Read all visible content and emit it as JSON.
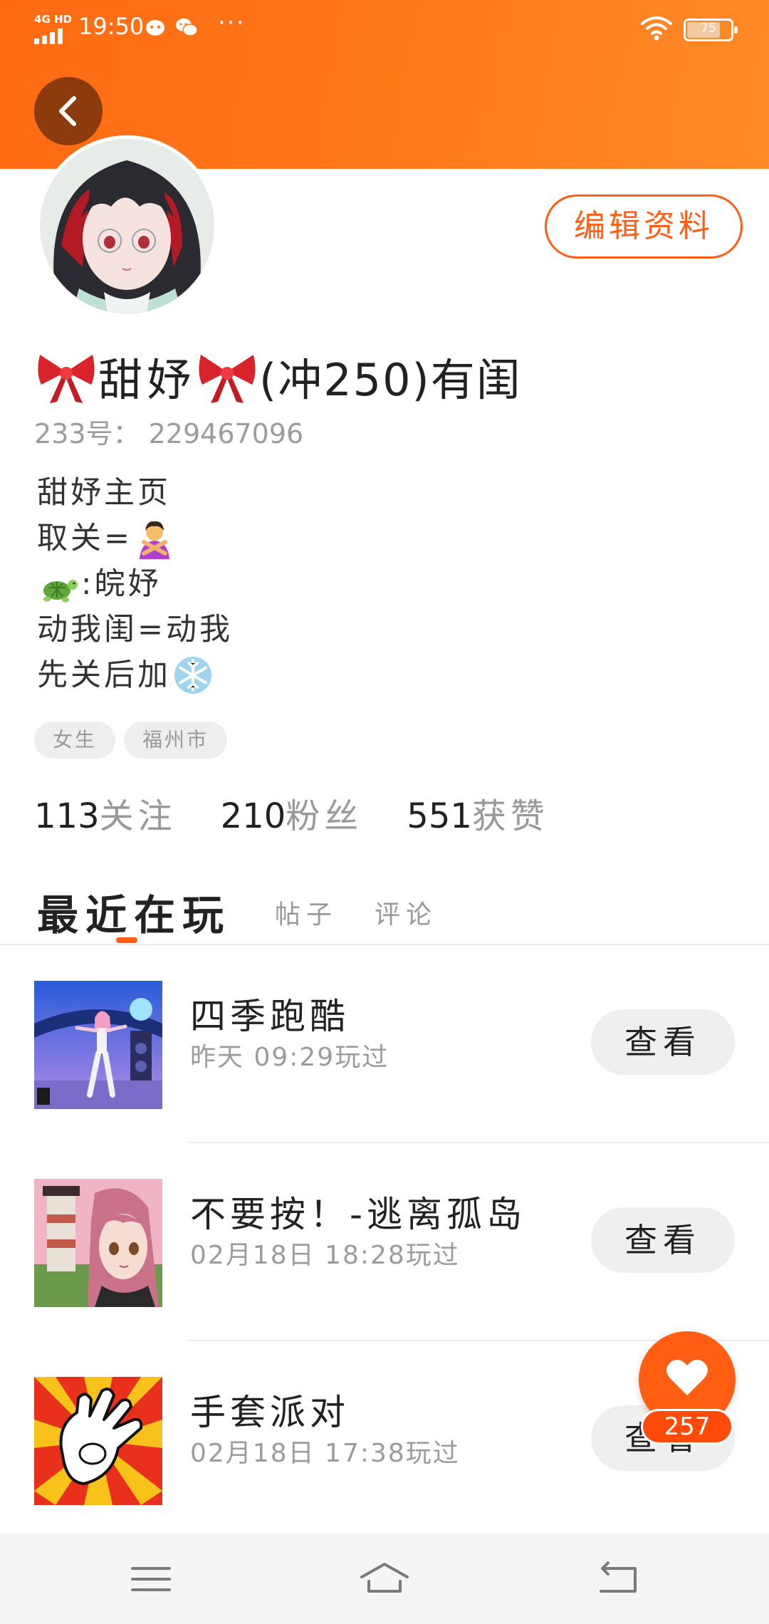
{
  "status_bar": {
    "network": "4G HD",
    "time": "19:50",
    "more": "···",
    "battery_level": "75"
  },
  "header": {
    "back_icon": "chevron-left-icon",
    "accent_color": "#ff6a12"
  },
  "profile": {
    "edit_button": "编辑资料",
    "name_icon": "ribbon-bow-icon",
    "name_part1": "甜妤",
    "name_part2": "(冲250)有闺",
    "uid": "233号： 229467096",
    "bio": {
      "line1": "甜妤主页",
      "line2": "取关=",
      "line2_emoji": "person-gesturing-no-icon",
      "line3_emoji": "turtle-icon",
      "line3": ":皖妤",
      "line4": "动我闺=动我",
      "line5": "先关后加",
      "line5_emoji": "snowflake-icon"
    },
    "tags": [
      "女生",
      "福州市"
    ],
    "stats": {
      "following_num": "113",
      "following_label": "关注",
      "fans_num": "210",
      "fans_label": "粉丝",
      "likes_num": "551",
      "likes_label": "获赞"
    }
  },
  "tabs": {
    "active": "最近在玩",
    "posts": "帖子",
    "comments": "评论"
  },
  "games": [
    {
      "name": "四季跑酷",
      "time": "昨天 09:29玩过",
      "button": "查看"
    },
    {
      "name": "不要按！-逃离孤岛",
      "time": "02月18日 18:28玩过",
      "button": "查看"
    },
    {
      "name": "手套派对",
      "time": "02月18日 17:38玩过",
      "button": "查看"
    }
  ],
  "like_fab": {
    "icon": "heart-icon",
    "count": "257"
  },
  "nav_bar": {
    "menu_icon": "menu-icon",
    "home_icon": "home-icon",
    "back_icon": "back-arrow-icon"
  }
}
